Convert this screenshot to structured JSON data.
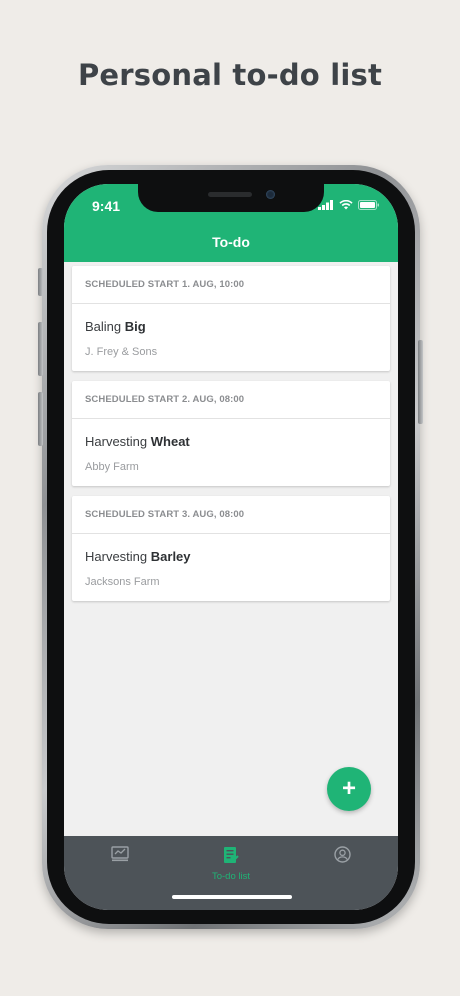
{
  "headline": "Personal to-do list",
  "status_bar": {
    "time": "9:41",
    "icons": [
      "signal-icon",
      "wifi-icon",
      "battery-icon"
    ]
  },
  "app_bar": {
    "title": "To-do"
  },
  "tasks": [
    {
      "scheduled": "SCHEDULED START 1. AUG, 10:00",
      "activity": "Baling",
      "crop": "Big",
      "farm": "J. Frey & Sons"
    },
    {
      "scheduled": "SCHEDULED START 2. AUG, 08:00",
      "activity": "Harvesting",
      "crop": "Wheat",
      "farm": "Abby Farm"
    },
    {
      "scheduled": "SCHEDULED START 3. AUG, 08:00",
      "activity": "Harvesting",
      "crop": "Barley",
      "farm": "Jacksons Farm"
    }
  ],
  "fab": {
    "label": "+"
  },
  "tab_bar": {
    "tabs": [
      {
        "label": "",
        "icon": "dashboard-icon",
        "active": false
      },
      {
        "label": "To-do list",
        "icon": "todo-list-icon",
        "active": true
      },
      {
        "label": "",
        "icon": "profile-icon",
        "active": false
      }
    ]
  },
  "colors": {
    "accent": "#1fb476",
    "tab_bar": "#4d5358",
    "tab_inactive": "#9aa0a5",
    "background": "#efece8",
    "headline": "#3e4348"
  }
}
